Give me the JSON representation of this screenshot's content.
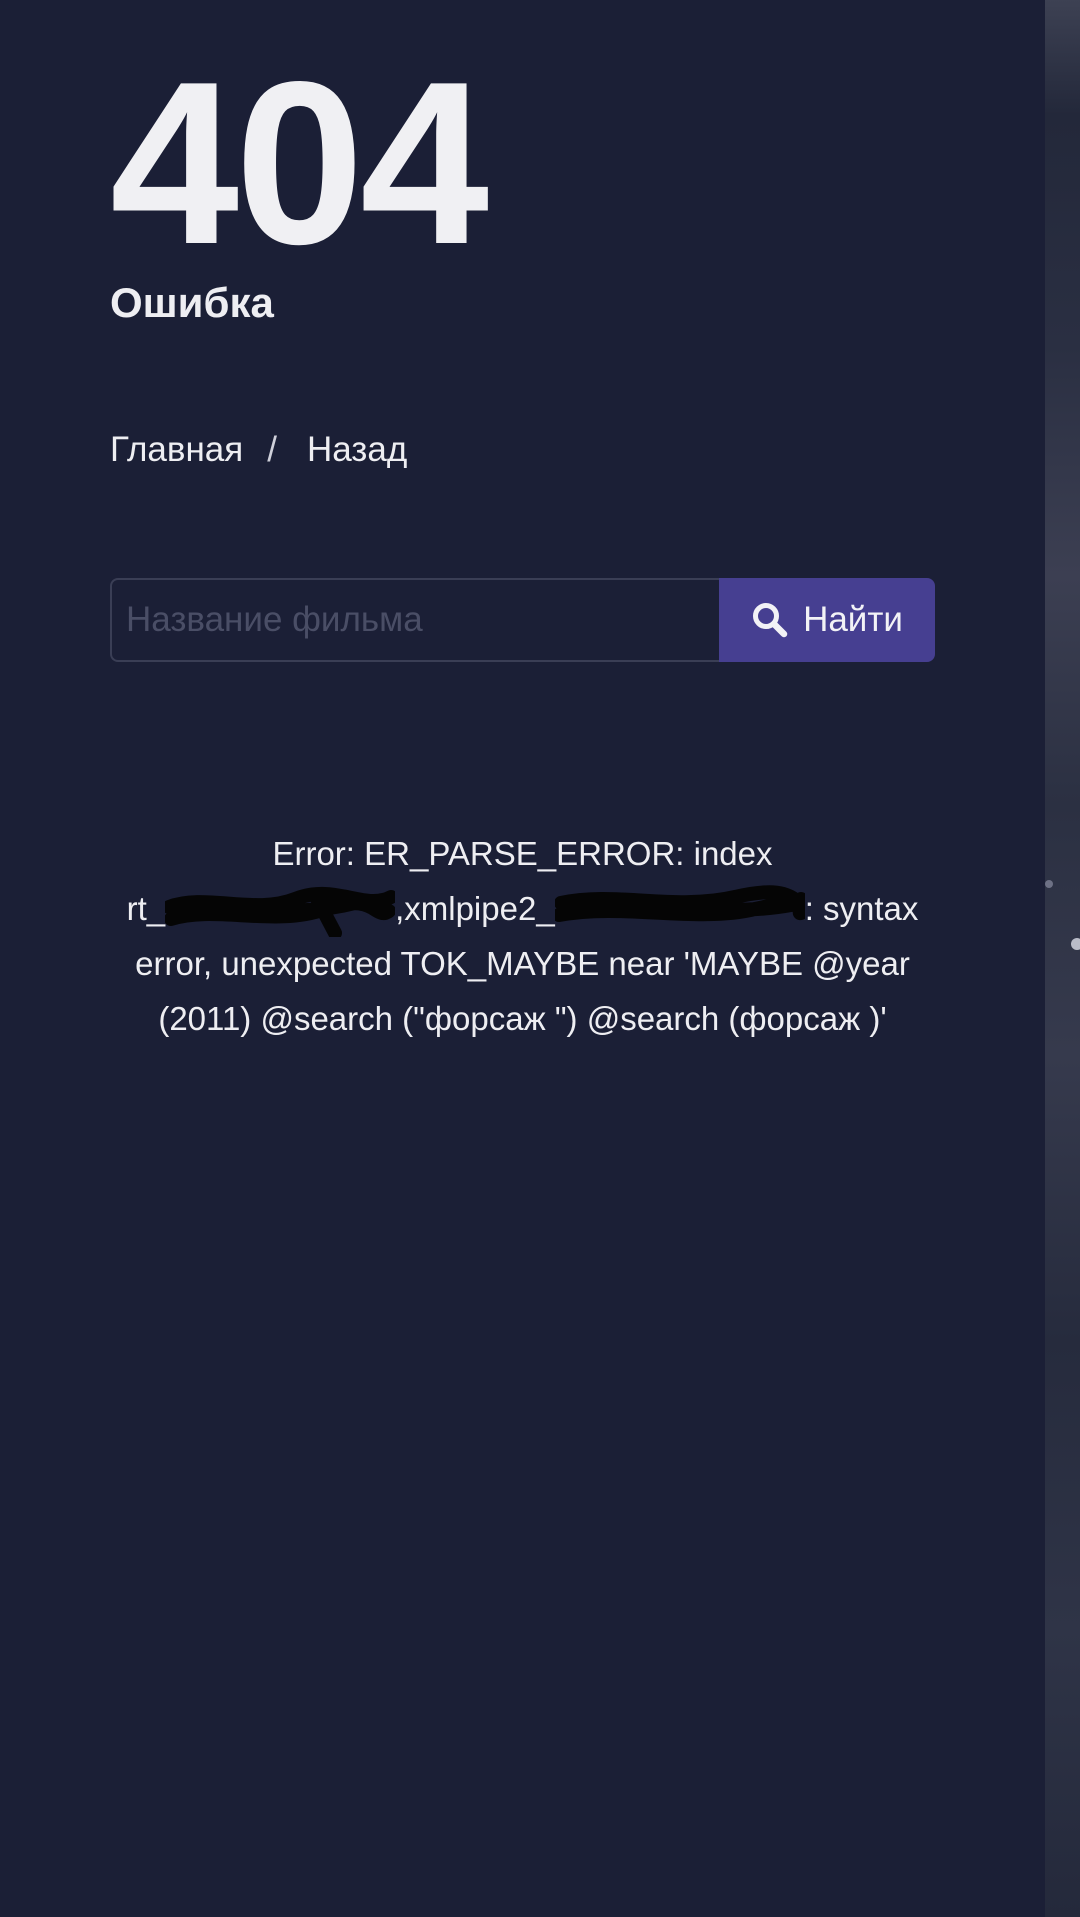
{
  "error": {
    "code": "404",
    "label": "Ошибка"
  },
  "breadcrumb": {
    "home_label": "Главная",
    "separator": "/",
    "back_label": "Назад"
  },
  "search": {
    "placeholder": "Название фильма",
    "value": "",
    "button_label": "Найти",
    "button_icon": "magnifier-icon",
    "button_color": "#463f91"
  },
  "message": {
    "line1": "Error: ER_PARSE_ERROR: index",
    "prefix1": "rt_",
    "middle": ",xmlpipe2_",
    "suffix": ": syntax error, unexpected TOK_MAYBE near 'MAYBE @year (2011) @search (\"форсаж \") @search (форсаж )'"
  },
  "theme": {
    "background": "#1b1f36",
    "text": "#eeeef2"
  }
}
